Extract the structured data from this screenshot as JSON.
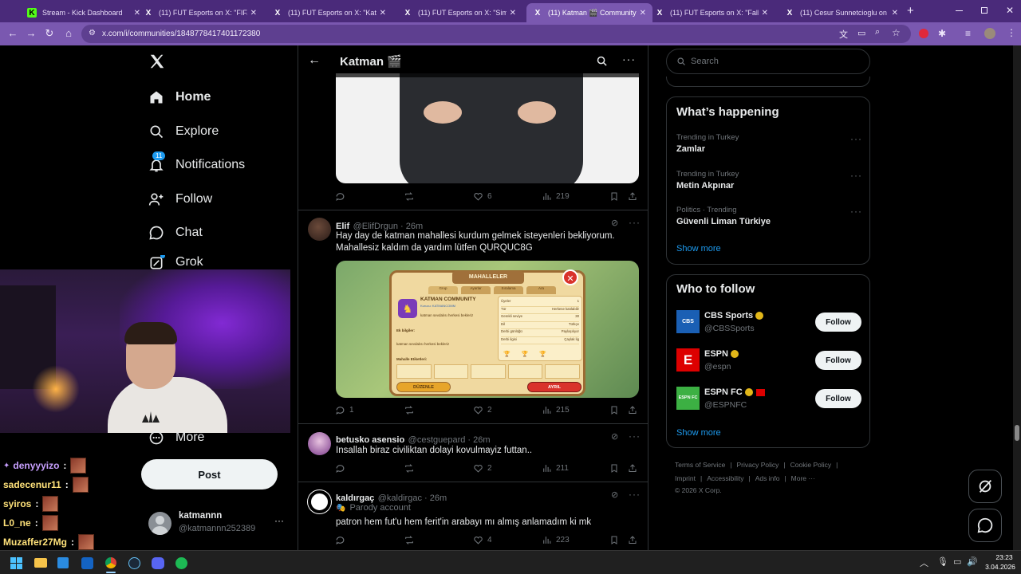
{
  "browser": {
    "tabs": [
      {
        "title": "Stream - Kick Dashboard",
        "fav": "K",
        "favbg": "#53fc18",
        "favfg": "#000",
        "active": false
      },
      {
        "title": "(11) FUT Esports on X: \"FIFA yay",
        "fav": "X",
        "favbg": "transparent",
        "favfg": "#fff",
        "active": false
      },
      {
        "title": "(11) FUT Esports on X: \"Katman",
        "fav": "X",
        "favbg": "transparent",
        "favfg": "#fff",
        "active": false
      },
      {
        "title": "(11) FUT Esports on X: \"Sims ta",
        "fav": "X",
        "favbg": "transparent",
        "favfg": "#fff",
        "active": false
      },
      {
        "title": "(11) Katman 🎬 Community / X",
        "fav": "X",
        "favbg": "transparent",
        "favfg": "#fff",
        "active": true
      },
      {
        "title": "(11) FUT Esports on X: \"Fall Guy",
        "fav": "X",
        "favbg": "transparent",
        "favfg": "#fff",
        "active": false
      },
      {
        "title": "(11) Cesur Sunnetcioglu on X: \"",
        "fav": "X",
        "favbg": "transparent",
        "favfg": "#fff",
        "active": false
      }
    ],
    "new_tab": "+",
    "url": "x.com/i/communities/1848778417401172380"
  },
  "sidebar": {
    "logo": "X",
    "items": [
      {
        "label": "Home",
        "icon": "home-icon"
      },
      {
        "label": "Explore",
        "icon": "search-icon"
      },
      {
        "label": "Notifications",
        "icon": "bell-icon",
        "badge": "11"
      },
      {
        "label": "Follow",
        "icon": "add-user-icon"
      },
      {
        "label": "Chat",
        "icon": "chat-icon"
      },
      {
        "label": "Grok",
        "icon": "grok-icon"
      },
      {
        "label": "More",
        "icon": "more-circle-icon"
      }
    ],
    "post_button": "Post",
    "account": {
      "name": "katmannn",
      "handle": "@katmannn252389",
      "more": "···"
    }
  },
  "stream_chat": [
    {
      "user": "denyyyizo",
      "color": "#c8a0ff"
    },
    {
      "user": "sadecenur11",
      "color": "#ffe27a"
    },
    {
      "user": "syiros",
      "color": "#ffe27a"
    },
    {
      "user": "L0_ne",
      "color": "#ffe27a"
    },
    {
      "user": "Muzaffer27Mg",
      "color": "#ffe27a"
    }
  ],
  "header": {
    "title": "Katman 🎬",
    "back": "←"
  },
  "tweets": [
    {
      "id": "t0",
      "actions": {
        "replies": "",
        "reposts": "",
        "likes": "6",
        "views": "219"
      }
    },
    {
      "id": "t1",
      "name": "Elif",
      "handle": "@ElifDrgun · 26m",
      "text": "Hay day de katman mahallesi kurdum gelmek isteyenleri bekliyorum. Mahallesiz kaldım da yardım lütfen QURQUC8G",
      "image": {
        "panel_title": "MAHALLELER",
        "tabs": [
          "Grup",
          "Ayarlar",
          "Sıralama",
          "Ara"
        ],
        "card_title": "KATMAN COMMUNITY",
        "subtitle": "Kurucu: KATMANCOMM",
        "desc": "katman sevdalısı herkesi bekleriz",
        "req_label": "Ek bilgiler:",
        "req_text": "katman sevdalısı herkesi bekleriz",
        "tags_label": "Mahalle Etiketleri:",
        "stats": [
          {
            "k": "Üyeler",
            "v": "1"
          },
          {
            "k": "Tür",
            "v": "Herkese katılabilir"
          },
          {
            "k": "Gerekli seviye",
            "v": "30"
          },
          {
            "k": "Dil",
            "v": "Türkçe"
          },
          {
            "k": "Derbi günlüğü",
            "v": "Paylaşılıyor"
          },
          {
            "k": "Derbi ilgisi",
            "v": "Çaylak lig"
          }
        ],
        "edit_btn": "DÜZENLE",
        "leave_btn": "AYRIL"
      },
      "actions": {
        "replies": "1",
        "reposts": "",
        "likes": "2",
        "views": "215"
      }
    },
    {
      "id": "t2",
      "name": "betusko asensio",
      "handle": "@cestguepard · 26m",
      "text": "Insallah biraz civiliktan dolayi kovulmayiz futtan..",
      "actions": {
        "replies": "",
        "reposts": "",
        "likes": "2",
        "views": "211"
      }
    },
    {
      "id": "t3",
      "name": "kaldırgaç",
      "handle": "@kaldirgac · 26m",
      "parody": "Parody account",
      "text": "patron hem fut'u hem ferit'in arabayı mı almış anlamadım ki mk",
      "actions": {
        "replies": "",
        "reposts": "",
        "likes": "4",
        "views": "223"
      }
    }
  ],
  "right": {
    "search_placeholder": "Search",
    "happening": {
      "title": "What’s happening",
      "items": [
        {
          "sub": "Trending in Turkey",
          "name": "Zamlar"
        },
        {
          "sub": "Trending in Turkey",
          "name": "Metin Akpınar"
        },
        {
          "sub": "Politics · Trending",
          "name": "Güvenli Liman Türkiye"
        }
      ],
      "show_more": "Show more"
    },
    "who_to_follow": {
      "title": "Who to follow",
      "items": [
        {
          "name": "CBS Sports",
          "handle": "@CBSSports",
          "logo": "CBS",
          "logo_bg": "#1a5fb4",
          "button": "Follow"
        },
        {
          "name": "ESPN",
          "handle": "@espn",
          "logo": "E",
          "logo_bg": "#d00",
          "button": "Follow"
        },
        {
          "name": "ESPN FC",
          "handle": "@ESPNFC",
          "logo": "ESPN FC",
          "logo_bg": "#3cb043",
          "button": "Follow"
        }
      ],
      "show_more": "Show more"
    },
    "footer": [
      "Terms of Service",
      "Privacy Policy",
      "Cookie Policy",
      "Imprint",
      "Accessibility",
      "Ads info",
      "More ···"
    ],
    "copyright": "© 2026 X Corp."
  },
  "taskbar": {
    "time": "23:23",
    "date": "3.04.2026"
  },
  "colors": {
    "accent": "#1d9bf0",
    "tabbar": "#4a2a7a",
    "addressbar": "#7a58b0"
  }
}
